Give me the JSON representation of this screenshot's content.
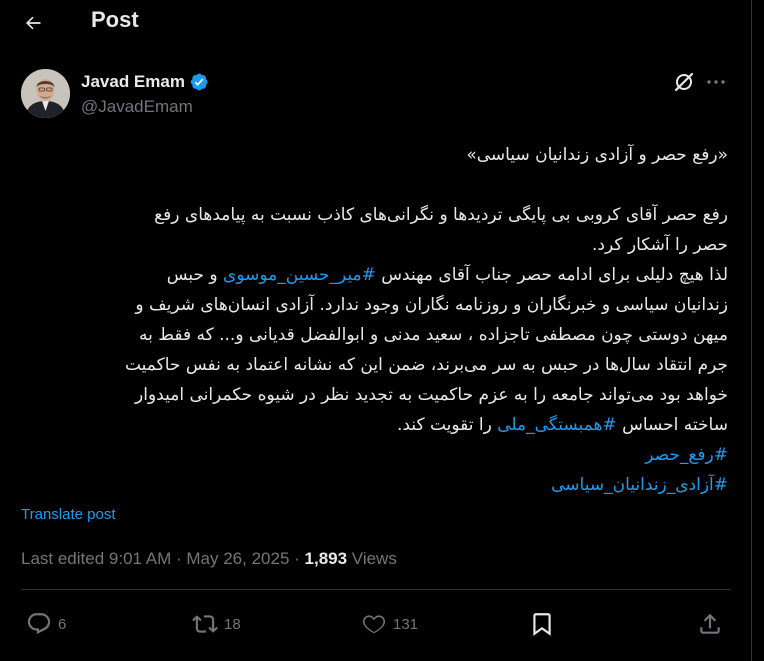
{
  "header": {
    "title": "Post"
  },
  "author": {
    "name": "Javad Emam",
    "handle": "@JavadEmam"
  },
  "post": {
    "lines": [
      {
        "segments": [
          {
            "text": "«رفع حصر و آزادی زندانیان سیاسی»",
            "tag": false
          }
        ]
      },
      {
        "gap": true
      },
      {
        "segments": [
          {
            "text": "رفع حصر آقای کروبی بی پایگی تردیدها و نگرانی‌های کاذب نسبت به پیامدهای رفع",
            "tag": false
          }
        ]
      },
      {
        "segments": [
          {
            "text": "حصر را آشکار کرد.",
            "tag": false
          }
        ]
      },
      {
        "segments": [
          {
            "text": "لذا هیچ دلیلی برای ادامه حصر جناب آقای مهندس ",
            "tag": false
          },
          {
            "text": "#میر_حسین_موسوی",
            "tag": true
          },
          {
            "text": " و حبس",
            "tag": false
          }
        ]
      },
      {
        "segments": [
          {
            "text": "زندانیان سیاسی و خبرنگاران و روزنامه نگاران وجود ندارد. آزادی انسان‌های شریف و",
            "tag": false
          }
        ]
      },
      {
        "segments": [
          {
            "text": "میهن دوستی چون مصطفی تاجزاده ، سعید مدنی و ابوالفضل قدیانی و... که فقط به",
            "tag": false
          }
        ]
      },
      {
        "segments": [
          {
            "text": "جرم انتقاد سال‌ها در حبس به سر می‌برند، ضمن این که نشانه اعتماد به نفس حاکمیت",
            "tag": false
          }
        ]
      },
      {
        "segments": [
          {
            "text": "خواهد بود می‌تواند جامعه را به عزم حاکمیت به تجدید نظر در شیوه حکمرانی امیدوار",
            "tag": false
          }
        ]
      },
      {
        "segments": [
          {
            "text": "ساخته احساس ",
            "tag": false
          },
          {
            "text": "#همبستگی_ملی",
            "tag": true
          },
          {
            "text": " را تقویت کند.",
            "tag": false
          }
        ]
      },
      {
        "segments": [
          {
            "text": "#رفع_حصر",
            "tag": true
          }
        ]
      },
      {
        "segments": [
          {
            "text": "#آزادی_زندانیان_سیاسی",
            "tag": true
          }
        ]
      }
    ]
  },
  "translate_label": "Translate post",
  "meta": {
    "edited": "Last edited 9:01 AM",
    "sep1": " · ",
    "date": "May 26, 2025",
    "sep2": " · ",
    "views_count": "1,893",
    "views_label": " Views"
  },
  "actions": {
    "replies": "6",
    "reposts": "18",
    "likes": "131"
  },
  "colors": {
    "background": "#000000",
    "text": "#e7e9ea",
    "muted": "#71767b",
    "accent": "#1d9bf0",
    "divider": "#2f3336"
  },
  "icons": {
    "back": "arrow-left-icon",
    "verified": "verified-badge-icon",
    "grok": "grok-icon",
    "more": "more-icon",
    "reply": "reply-icon",
    "repost": "repost-icon",
    "like": "heart-icon",
    "bookmark": "bookmark-icon",
    "share": "share-icon"
  }
}
